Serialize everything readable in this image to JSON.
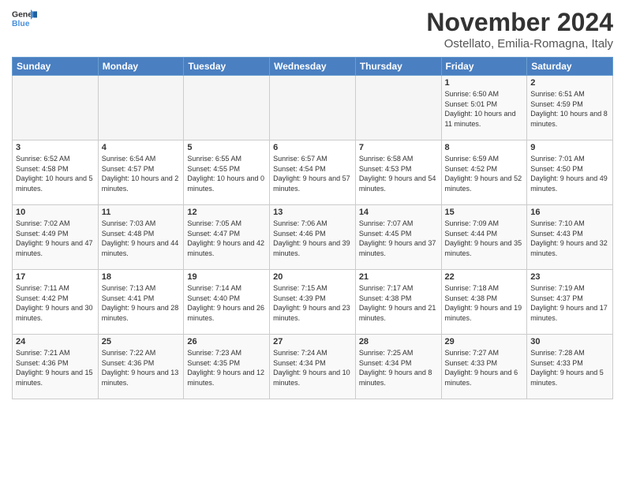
{
  "header": {
    "logo_line1": "General",
    "logo_line2": "Blue",
    "month_title": "November 2024",
    "subtitle": "Ostellato, Emilia-Romagna, Italy"
  },
  "days_of_week": [
    "Sunday",
    "Monday",
    "Tuesday",
    "Wednesday",
    "Thursday",
    "Friday",
    "Saturday"
  ],
  "weeks": [
    [
      {
        "day": "",
        "info": ""
      },
      {
        "day": "",
        "info": ""
      },
      {
        "day": "",
        "info": ""
      },
      {
        "day": "",
        "info": ""
      },
      {
        "day": "",
        "info": ""
      },
      {
        "day": "1",
        "info": "Sunrise: 6:50 AM\nSunset: 5:01 PM\nDaylight: 10 hours and 11 minutes."
      },
      {
        "day": "2",
        "info": "Sunrise: 6:51 AM\nSunset: 4:59 PM\nDaylight: 10 hours and 8 minutes."
      }
    ],
    [
      {
        "day": "3",
        "info": "Sunrise: 6:52 AM\nSunset: 4:58 PM\nDaylight: 10 hours and 5 minutes."
      },
      {
        "day": "4",
        "info": "Sunrise: 6:54 AM\nSunset: 4:57 PM\nDaylight: 10 hours and 2 minutes."
      },
      {
        "day": "5",
        "info": "Sunrise: 6:55 AM\nSunset: 4:55 PM\nDaylight: 10 hours and 0 minutes."
      },
      {
        "day": "6",
        "info": "Sunrise: 6:57 AM\nSunset: 4:54 PM\nDaylight: 9 hours and 57 minutes."
      },
      {
        "day": "7",
        "info": "Sunrise: 6:58 AM\nSunset: 4:53 PM\nDaylight: 9 hours and 54 minutes."
      },
      {
        "day": "8",
        "info": "Sunrise: 6:59 AM\nSunset: 4:52 PM\nDaylight: 9 hours and 52 minutes."
      },
      {
        "day": "9",
        "info": "Sunrise: 7:01 AM\nSunset: 4:50 PM\nDaylight: 9 hours and 49 minutes."
      }
    ],
    [
      {
        "day": "10",
        "info": "Sunrise: 7:02 AM\nSunset: 4:49 PM\nDaylight: 9 hours and 47 minutes."
      },
      {
        "day": "11",
        "info": "Sunrise: 7:03 AM\nSunset: 4:48 PM\nDaylight: 9 hours and 44 minutes."
      },
      {
        "day": "12",
        "info": "Sunrise: 7:05 AM\nSunset: 4:47 PM\nDaylight: 9 hours and 42 minutes."
      },
      {
        "day": "13",
        "info": "Sunrise: 7:06 AM\nSunset: 4:46 PM\nDaylight: 9 hours and 39 minutes."
      },
      {
        "day": "14",
        "info": "Sunrise: 7:07 AM\nSunset: 4:45 PM\nDaylight: 9 hours and 37 minutes."
      },
      {
        "day": "15",
        "info": "Sunrise: 7:09 AM\nSunset: 4:44 PM\nDaylight: 9 hours and 35 minutes."
      },
      {
        "day": "16",
        "info": "Sunrise: 7:10 AM\nSunset: 4:43 PM\nDaylight: 9 hours and 32 minutes."
      }
    ],
    [
      {
        "day": "17",
        "info": "Sunrise: 7:11 AM\nSunset: 4:42 PM\nDaylight: 9 hours and 30 minutes."
      },
      {
        "day": "18",
        "info": "Sunrise: 7:13 AM\nSunset: 4:41 PM\nDaylight: 9 hours and 28 minutes."
      },
      {
        "day": "19",
        "info": "Sunrise: 7:14 AM\nSunset: 4:40 PM\nDaylight: 9 hours and 26 minutes."
      },
      {
        "day": "20",
        "info": "Sunrise: 7:15 AM\nSunset: 4:39 PM\nDaylight: 9 hours and 23 minutes."
      },
      {
        "day": "21",
        "info": "Sunrise: 7:17 AM\nSunset: 4:38 PM\nDaylight: 9 hours and 21 minutes."
      },
      {
        "day": "22",
        "info": "Sunrise: 7:18 AM\nSunset: 4:38 PM\nDaylight: 9 hours and 19 minutes."
      },
      {
        "day": "23",
        "info": "Sunrise: 7:19 AM\nSunset: 4:37 PM\nDaylight: 9 hours and 17 minutes."
      }
    ],
    [
      {
        "day": "24",
        "info": "Sunrise: 7:21 AM\nSunset: 4:36 PM\nDaylight: 9 hours and 15 minutes."
      },
      {
        "day": "25",
        "info": "Sunrise: 7:22 AM\nSunset: 4:36 PM\nDaylight: 9 hours and 13 minutes."
      },
      {
        "day": "26",
        "info": "Sunrise: 7:23 AM\nSunset: 4:35 PM\nDaylight: 9 hours and 12 minutes."
      },
      {
        "day": "27",
        "info": "Sunrise: 7:24 AM\nSunset: 4:34 PM\nDaylight: 9 hours and 10 minutes."
      },
      {
        "day": "28",
        "info": "Sunrise: 7:25 AM\nSunset: 4:34 PM\nDaylight: 9 hours and 8 minutes."
      },
      {
        "day": "29",
        "info": "Sunrise: 7:27 AM\nSunset: 4:33 PM\nDaylight: 9 hours and 6 minutes."
      },
      {
        "day": "30",
        "info": "Sunrise: 7:28 AM\nSunset: 4:33 PM\nDaylight: 9 hours and 5 minutes."
      }
    ]
  ]
}
